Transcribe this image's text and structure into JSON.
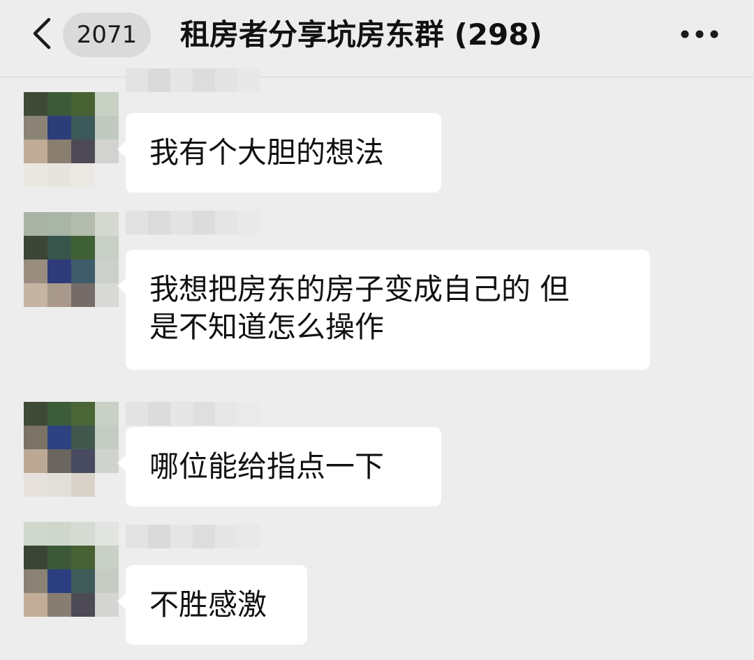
{
  "header": {
    "back_icon": "chevron-left-icon",
    "unread_count": "2071",
    "title": "租房者分享坑房东群 (298)",
    "more_icon": "ellipsis-icon"
  },
  "messages": [
    {
      "text": "我有个大胆的想法"
    },
    {
      "text": "我想把房东的房子变成自己的 但\n是不知道怎么操作"
    },
    {
      "text": "哪位能给指点一下"
    },
    {
      "text": "不胜感激"
    }
  ],
  "colors": {
    "background": "#ededed",
    "bubble": "#ffffff",
    "badge": "#dadada",
    "text": "#111111"
  }
}
